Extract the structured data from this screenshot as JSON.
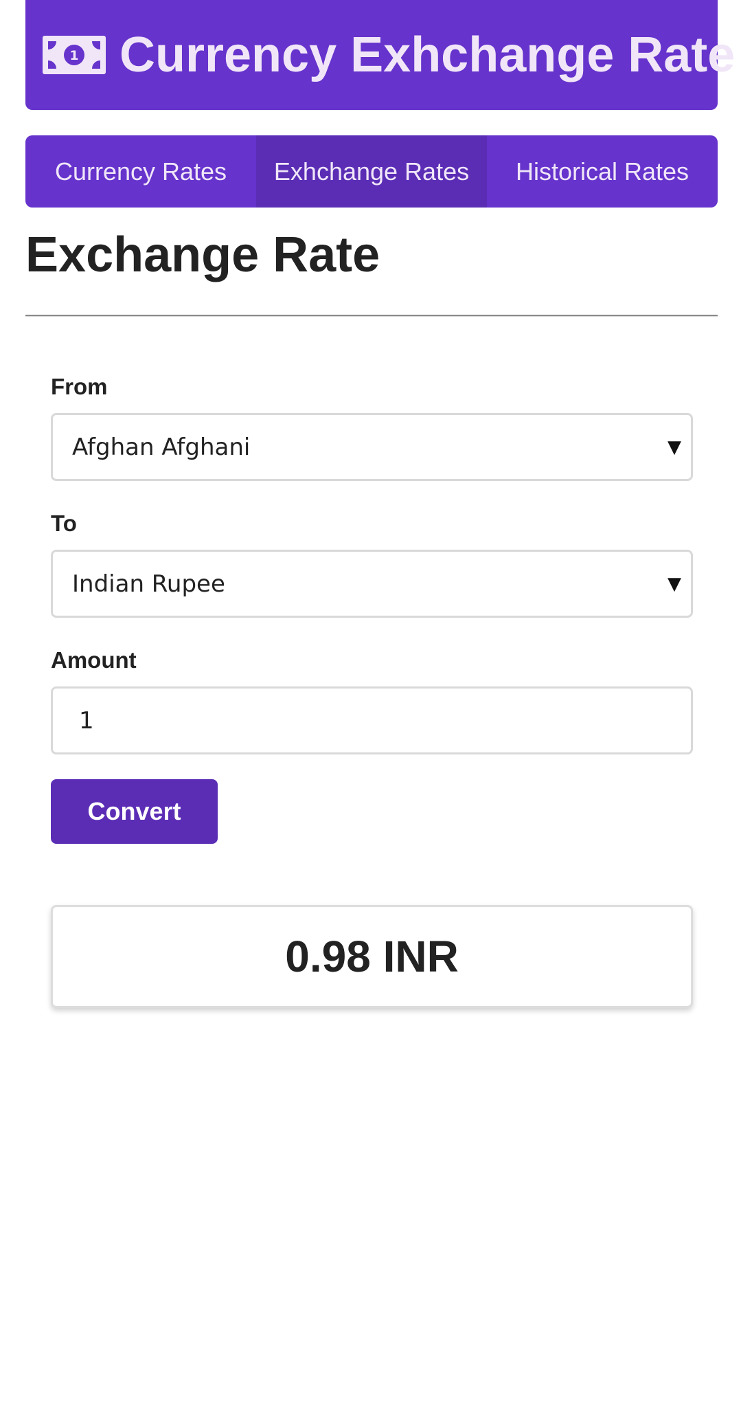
{
  "header": {
    "icon": "money-bill-icon",
    "title": "Currency Exhchange Rate"
  },
  "nav": {
    "tabs": [
      {
        "label": "Currency Rates",
        "active": false
      },
      {
        "label": "Exhchange Rates",
        "active": true
      },
      {
        "label": "Historical Rates",
        "active": false
      }
    ]
  },
  "main": {
    "title": "Exchange Rate",
    "form": {
      "from_label": "From",
      "from_value": "Afghan Afghani",
      "to_label": "To",
      "to_value": "Indian Rupee",
      "amount_label": "Amount",
      "amount_value": "1",
      "convert_label": "Convert"
    },
    "result": "0.98 INR"
  },
  "colors": {
    "brand": "#6633cc",
    "brand_dark": "#5b2db5",
    "header_text": "#f0e6f8"
  }
}
